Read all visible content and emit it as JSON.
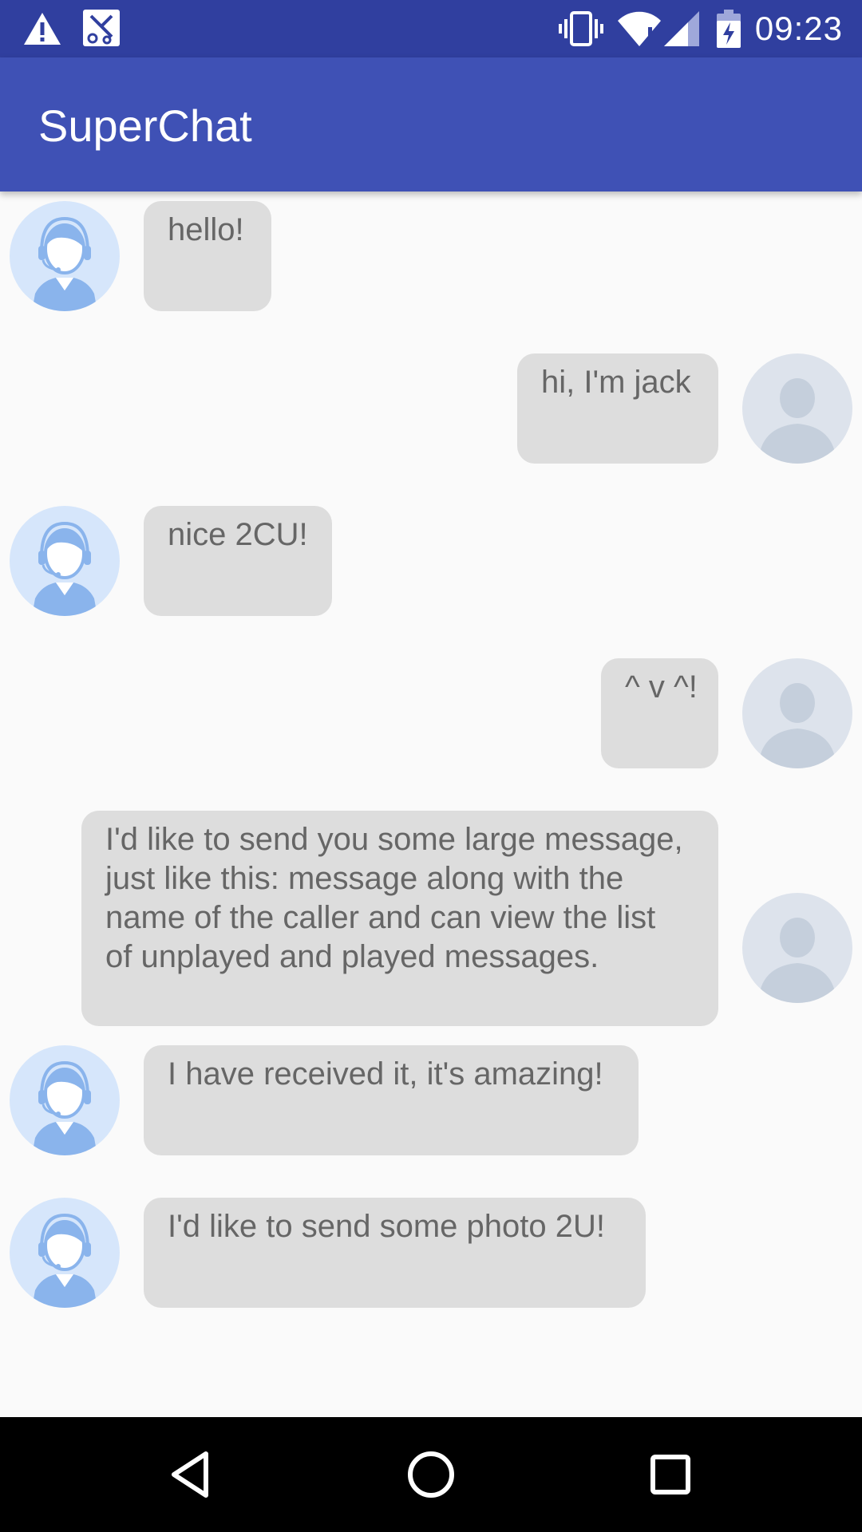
{
  "status_bar": {
    "time": "09:23",
    "icons": [
      "warning-icon",
      "scissors-notification-icon",
      "vibrate-icon",
      "wifi-icon",
      "signal-icon",
      "battery-charging-icon"
    ]
  },
  "app_bar": {
    "title": "SuperChat"
  },
  "messages": [
    {
      "side": "received",
      "avatar": "agent-avatar-icon",
      "text": "hello!"
    },
    {
      "side": "sent",
      "avatar": "user-avatar-icon",
      "text": "hi, I'm jack"
    },
    {
      "side": "received",
      "avatar": "agent-avatar-icon",
      "text": "nice 2CU!"
    },
    {
      "side": "sent",
      "avatar": "user-avatar-icon",
      "text": "^ v ^!"
    },
    {
      "side": "sent",
      "avatar": "user-avatar-icon",
      "text": "I'd like to send you some large message, just like this: message along with the name of the caller and can view the list of unplayed and played messages."
    },
    {
      "side": "received",
      "avatar": "agent-avatar-icon",
      "text": "I have received it, it's amazing!"
    },
    {
      "side": "received",
      "avatar": "agent-avatar-icon",
      "text": "I'd like to send some photo 2U!"
    }
  ],
  "nav_bar": {
    "buttons": [
      "back-icon",
      "home-icon",
      "recents-icon"
    ]
  },
  "colors": {
    "status_bar": "#303f9f",
    "app_bar": "#3f51b5",
    "background": "#fafafa",
    "bubble": "#dddddd",
    "bubble_text": "#666666",
    "agent_avatar_bg": "#d6e6fb",
    "agent_avatar_fg": "#8ab4ec",
    "user_avatar_bg": "#dde3ec",
    "user_avatar_fg": "#c5cfdc"
  }
}
